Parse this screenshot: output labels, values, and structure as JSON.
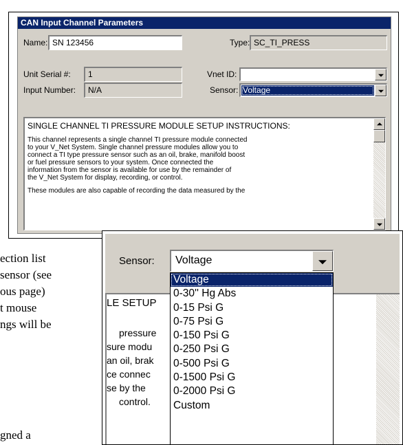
{
  "dialog1": {
    "title": "CAN Input Channel Parameters",
    "name_label": "Name:",
    "name_value": "SN 123456",
    "type_label": "Type:",
    "type_value": "SC_TI_PRESS",
    "unit_serial_label": "Unit Serial #:",
    "unit_serial_value": "1",
    "vnet_id_label": "Vnet ID:",
    "vnet_id_value": "",
    "input_number_label": "Input Number:",
    "input_number_value": "N/A",
    "sensor_label": "Sensor:",
    "sensor_value": "Voltage",
    "instructions_heading": "SINGLE CHANNEL TI PRESSURE MODULE SETUP INSTRUCTIONS:",
    "instructions_para1_lines": [
      "This channel represents a single channel TI pressure module connected",
      "to your V_Net System.  Single channel pressure modules allow you to",
      "connect a TI type pressure sensor such as an oil, brake, manifold boost",
      "or fuel pressure sensors to your system.  Once connected the",
      "information from the sensor is available for use by the remainder of",
      "the V_Net System for display, recording, or control."
    ],
    "instructions_para2_lines": [
      "These modules are also capable of recording the data measured by the"
    ]
  },
  "doc_fragments": [
    "ection list",
    "sensor (see",
    "ous page)",
    "t mouse",
    "ngs will be",
    "gned a"
  ],
  "dialog2": {
    "sensor_label": "Sensor:",
    "sensor_value": "Voltage",
    "options": [
      "Voltage",
      "0-30'' Hg  Abs",
      "0-15 Psi G",
      "0-75 Psi G",
      "0-150 Psi G",
      "0-250 Psi G",
      "0-500 Psi G",
      "0-1500 Psi G",
      "0-2000 Psi G",
      "Custom"
    ],
    "selected_option": "Voltage",
    "background_fragments": [
      "LE SETUP",
      "pressure",
      "sure modu",
      "an oil, brak",
      "ce connec",
      "se by the",
      "control."
    ]
  },
  "colors": {
    "title_bar": "#0a246a",
    "dialog_face": "#d4d0c8",
    "highlight": "#0a246a",
    "highlight_text": "#ffffff"
  }
}
